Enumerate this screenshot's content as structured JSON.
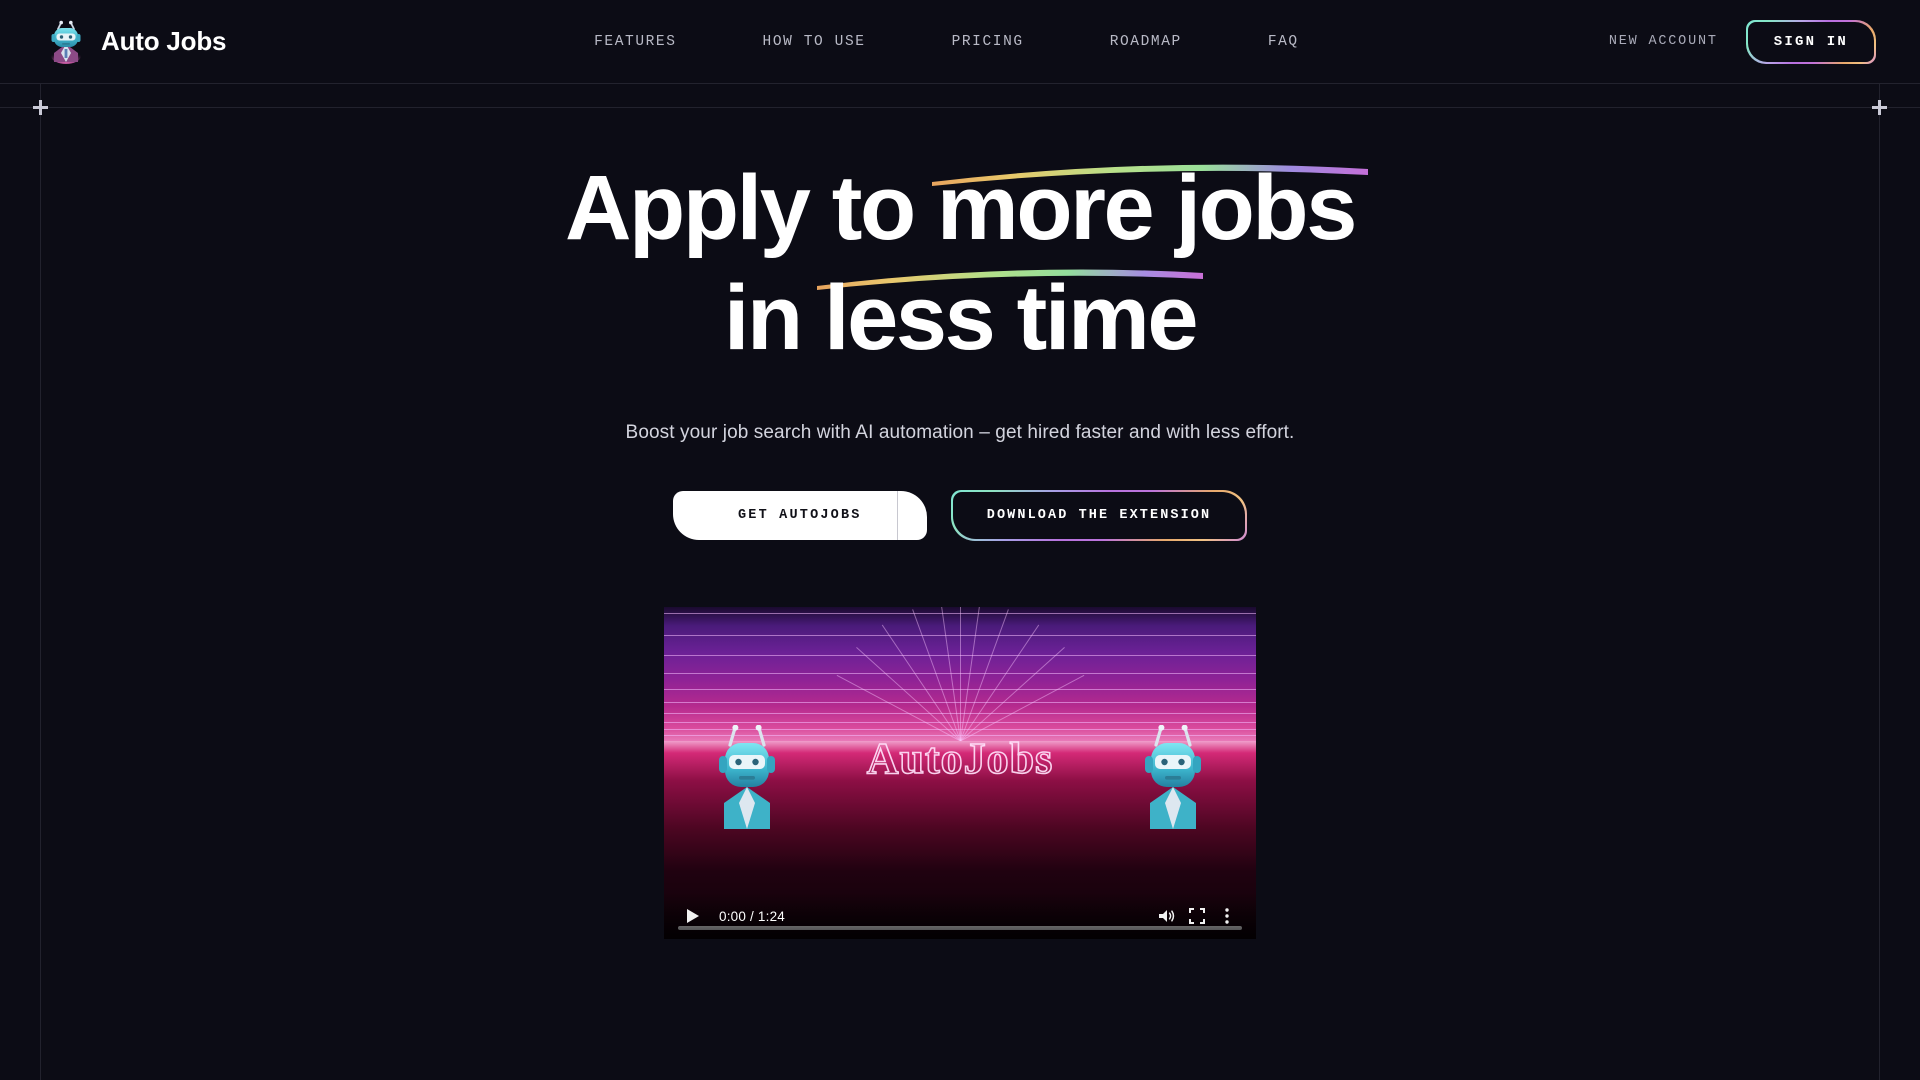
{
  "brand": {
    "name": "Auto Jobs",
    "logo_icon": "robot-avatar-icon"
  },
  "nav": {
    "items": [
      {
        "label": "FEATURES"
      },
      {
        "label": "HOW TO USE"
      },
      {
        "label": "PRICING"
      },
      {
        "label": "ROADMAP"
      },
      {
        "label": "FAQ"
      }
    ],
    "new_account_label": "NEW ACCOUNT",
    "sign_in_label": "SIGN IN"
  },
  "hero": {
    "headline_line1": "Apply to more jobs",
    "headline_line2": "in less time",
    "subtitle": "Boost your job search with AI automation – get hired faster and with less effort.",
    "cta_primary": "GET AUTOJOBS",
    "cta_secondary": "DOWNLOAD THE EXTENSION"
  },
  "video": {
    "title_text": "AutoJobs",
    "current_time": "0:00",
    "duration": "1:24",
    "time_display": "0:00 / 1:24",
    "play_icon": "play-icon",
    "volume_icon": "volume-icon",
    "fullscreen_icon": "fullscreen-icon",
    "more_icon": "more-options-icon",
    "progress_percent": 0
  },
  "colors": {
    "background": "#0c0c15",
    "header_border": "#23232e",
    "guide_line": "#22222d",
    "nav_text": "#b9bac6",
    "heading_text": "#ffffff",
    "subtitle_text": "#d3d4de",
    "gradient_teal": "#7fe7d4",
    "gradient_purple": "#b873de",
    "gradient_orange": "#e8a86a",
    "gradient_green": "#9fe08a",
    "cta_primary_bg": "#ffffff",
    "cta_primary_text": "#111118"
  }
}
